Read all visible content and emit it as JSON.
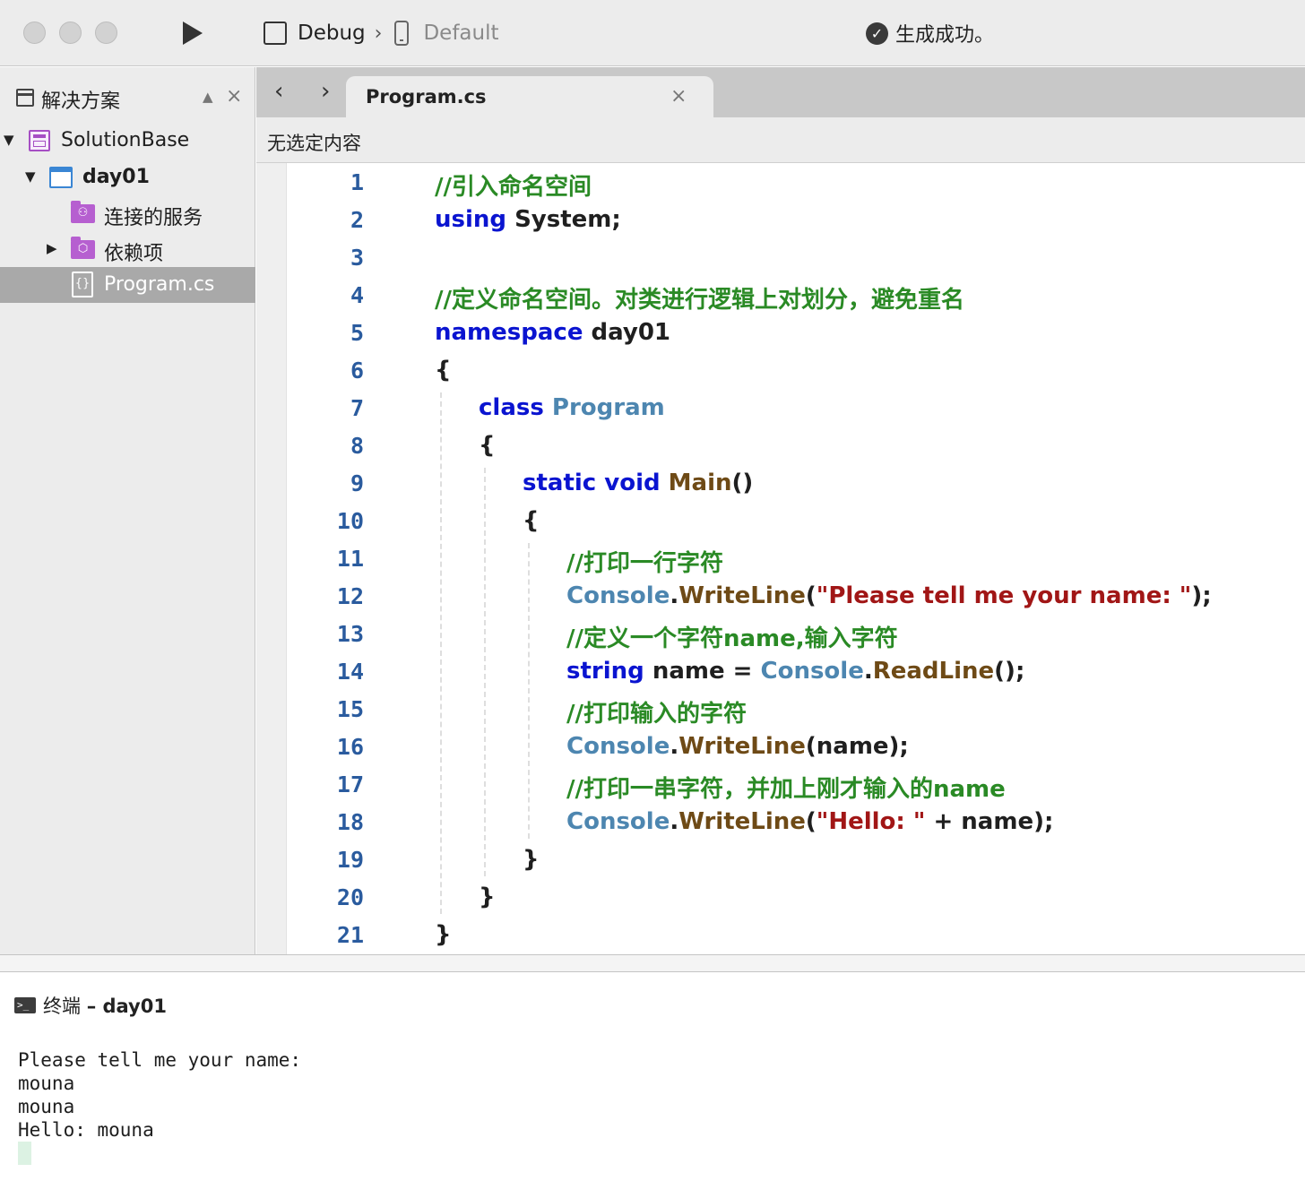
{
  "toolbar": {
    "config": "Debug",
    "separator": "›",
    "device": "Default",
    "status": "生成成功。",
    "status_check_glyph": "✓"
  },
  "sidebar": {
    "title": "解决方案",
    "pin_glyph": "📌",
    "close_glyph": "×",
    "tree": [
      {
        "label": "SolutionBase",
        "icon": "solution-icon",
        "expanded": true
      },
      {
        "label": "day01",
        "icon": "project-icon",
        "expanded": true
      },
      {
        "label": "连接的服务",
        "icon": "connected-services-folder-icon",
        "glyph": "⚇"
      },
      {
        "label": "依赖项",
        "icon": "dependencies-folder-icon",
        "glyph": "⬡",
        "expanded": false
      },
      {
        "label": "Program.cs",
        "icon": "csharp-file-icon",
        "glyph": "{}",
        "selected": true
      }
    ]
  },
  "editor": {
    "tab_label": "Program.cs",
    "tab_close": "×",
    "nav_back": "‹",
    "nav_forward": "›",
    "breadcrumb": "无选定内容",
    "lines": [
      {
        "n": "1",
        "indent": 0,
        "tokens": [
          [
            "cmt",
            "//引入命名空间"
          ]
        ]
      },
      {
        "n": "2",
        "indent": 0,
        "tokens": [
          [
            "kw",
            "using"
          ],
          [
            "",
            " System;"
          ]
        ]
      },
      {
        "n": "3",
        "indent": 0,
        "tokens": []
      },
      {
        "n": "4",
        "indent": 0,
        "tokens": [
          [
            "cmt",
            "//定义命名空间。对类进行逻辑上对划分，避免重名"
          ]
        ]
      },
      {
        "n": "5",
        "indent": 0,
        "tokens": [
          [
            "kw",
            "namespace"
          ],
          [
            "",
            " day01"
          ]
        ]
      },
      {
        "n": "6",
        "indent": 0,
        "tokens": [
          [
            "",
            "{"
          ]
        ]
      },
      {
        "n": "7",
        "indent": 1,
        "tokens": [
          [
            "kw",
            "class"
          ],
          [
            "",
            " "
          ],
          [
            "typ",
            "Program"
          ]
        ]
      },
      {
        "n": "8",
        "indent": 1,
        "tokens": [
          [
            "",
            "{"
          ]
        ]
      },
      {
        "n": "9",
        "indent": 2,
        "tokens": [
          [
            "kw",
            "static"
          ],
          [
            "",
            " "
          ],
          [
            "kw",
            "void"
          ],
          [
            "",
            " "
          ],
          [
            "mth",
            "Main"
          ],
          [
            "",
            "()"
          ]
        ]
      },
      {
        "n": "10",
        "indent": 2,
        "tokens": [
          [
            "",
            "{"
          ]
        ]
      },
      {
        "n": "11",
        "indent": 3,
        "tokens": [
          [
            "cmt",
            "//打印一行字符"
          ]
        ]
      },
      {
        "n": "12",
        "indent": 3,
        "tokens": [
          [
            "typ",
            "Console"
          ],
          [
            "",
            "."
          ],
          [
            "mth",
            "WriteLine"
          ],
          [
            "",
            "("
          ],
          [
            "str",
            "\"Please tell me your name: \""
          ],
          [
            "",
            ");"
          ]
        ]
      },
      {
        "n": "13",
        "indent": 3,
        "tokens": [
          [
            "cmt",
            "//定义一个字符name,输入字符"
          ]
        ]
      },
      {
        "n": "14",
        "indent": 3,
        "tokens": [
          [
            "kw",
            "string"
          ],
          [
            "",
            " name = "
          ],
          [
            "typ",
            "Console"
          ],
          [
            "",
            "."
          ],
          [
            "mth",
            "ReadLine"
          ],
          [
            "",
            "();"
          ]
        ]
      },
      {
        "n": "15",
        "indent": 3,
        "tokens": [
          [
            "cmt",
            "//打印输入的字符"
          ]
        ]
      },
      {
        "n": "16",
        "indent": 3,
        "tokens": [
          [
            "typ",
            "Console"
          ],
          [
            "",
            "."
          ],
          [
            "mth",
            "WriteLine"
          ],
          [
            "",
            "(name);"
          ]
        ]
      },
      {
        "n": "17",
        "indent": 3,
        "tokens": [
          [
            "cmt",
            "//打印一串字符，并加上刚才输入的name"
          ]
        ]
      },
      {
        "n": "18",
        "indent": 3,
        "tokens": [
          [
            "typ",
            "Console"
          ],
          [
            "",
            "."
          ],
          [
            "mth",
            "WriteLine"
          ],
          [
            "",
            "("
          ],
          [
            "str",
            "\"Hello: \""
          ],
          [
            "",
            " + name);"
          ]
        ]
      },
      {
        "n": "19",
        "indent": 2,
        "tokens": [
          [
            "",
            "}"
          ]
        ]
      },
      {
        "n": "20",
        "indent": 1,
        "tokens": [
          [
            "",
            "}"
          ]
        ]
      },
      {
        "n": "21",
        "indent": 0,
        "tokens": [
          [
            "",
            "}"
          ]
        ]
      }
    ]
  },
  "terminal": {
    "title_prefix": "终端",
    "title_suffix": "– day01",
    "icon_glyph": ">_",
    "output": [
      "Please tell me your name:",
      "mouna",
      "mouna",
      "Hello: mouna"
    ]
  },
  "colors": {
    "keyword": "#0a14d0",
    "type": "#4d86b0",
    "method": "#6e4a16",
    "string": "#a11616",
    "comment": "#2a8a25",
    "line_number": "#2a5b9e",
    "selection": "#a9a9a9",
    "project_accent": "#a64fc4"
  }
}
